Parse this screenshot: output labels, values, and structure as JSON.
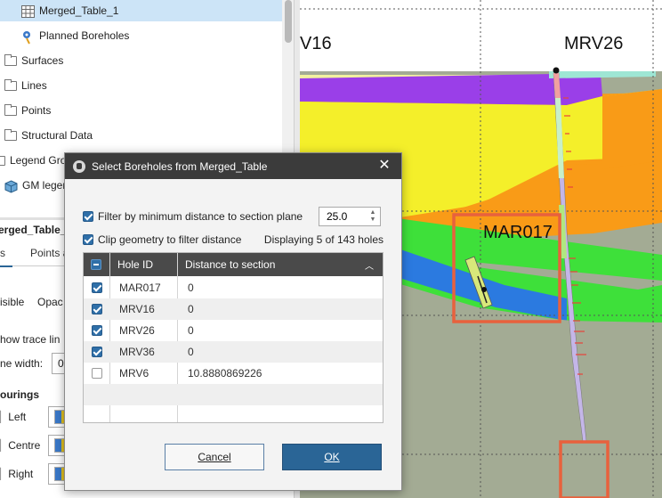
{
  "tree": {
    "items": [
      {
        "label": "Merged_Table_1",
        "icon": "table-icon",
        "selected": true
      },
      {
        "label": "Planned Boreholes",
        "icon": "planned-borehole-icon"
      },
      {
        "label": "Surfaces",
        "icon": "folder-icon"
      },
      {
        "label": "Lines",
        "icon": "folder-icon"
      },
      {
        "label": "Points",
        "icon": "folder-icon"
      },
      {
        "label": "Structural Data",
        "icon": "folder-icon"
      },
      {
        "label": "Legend Grou",
        "icon": "folder-icon"
      },
      {
        "label": "GM legen",
        "icon": "cube-icon"
      }
    ]
  },
  "properties": {
    "title": "erged_Table_",
    "tabs": [
      "s",
      "Points a"
    ],
    "visible_label": "isible",
    "opacity_label": "Opac",
    "show_trace_label": "how trace lin",
    "line_width_label": "ne width:",
    "line_width_value": "0",
    "colourings_label": "ourings",
    "left_label": "Left",
    "centre_label": "Centre",
    "right_label": "Right"
  },
  "scene": {
    "labels": [
      "V16",
      "MRV26",
      "MAR017"
    ],
    "colors": {
      "background": "#a3ab94",
      "purple": "#9a3fe8",
      "yellow": "#f4ef2a",
      "light_yellow": "#f2f1a0",
      "orange": "#f99b17",
      "blue": "#2b7ae0",
      "green": "#3ee03a",
      "highlight_box": "#e8613d",
      "tick_red": "#e8443a"
    }
  },
  "dialog": {
    "title": "Select Boreholes from Merged_Table",
    "filter_label": "Filter by minimum distance to section plane",
    "filter_checked": true,
    "min_distance": "25.0",
    "clip_label": "Clip geometry to filter distance",
    "clip_checked": true,
    "status": "Displaying 5 of 143 holes",
    "columns": [
      "Hole ID",
      "Distance to section"
    ],
    "rows": [
      {
        "hole_id": "MAR017",
        "distance": "0",
        "checked": true
      },
      {
        "hole_id": "MRV16",
        "distance": "0",
        "checked": true
      },
      {
        "hole_id": "MRV26",
        "distance": "0",
        "checked": true
      },
      {
        "hole_id": "MRV36",
        "distance": "0",
        "checked": true
      },
      {
        "hole_id": "MRV6",
        "distance": "10.8880869226",
        "checked": false
      }
    ],
    "cancel_label": "Cancel",
    "ok_label": "OK"
  }
}
